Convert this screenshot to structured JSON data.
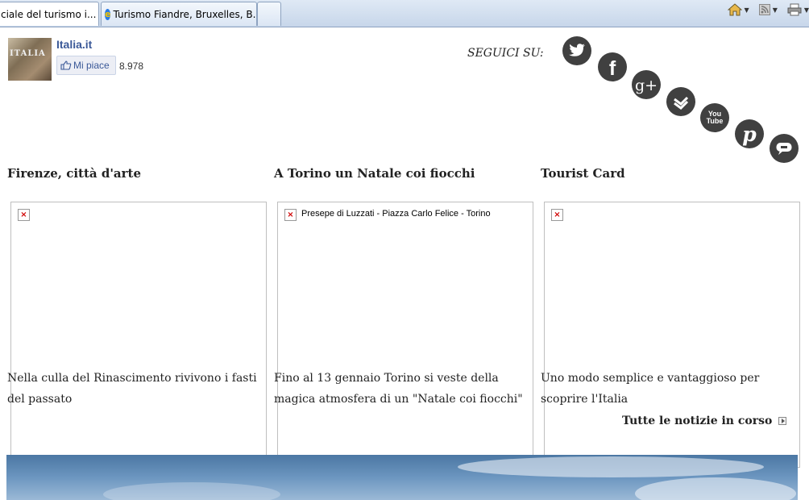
{
  "browser": {
    "tabs": [
      {
        "label": "ciale del turismo i...",
        "active": true
      },
      {
        "label": "Turismo Fiandre, Bruxelles, B...",
        "active": false
      },
      {
        "label": "",
        "active": false
      }
    ],
    "tools": [
      "home-icon",
      "feed-icon",
      "print-icon"
    ]
  },
  "header": {
    "site_name": "Italia.it",
    "thumb_text": "ITALIA",
    "like_label": "Mi piace",
    "like_count": "8.978",
    "follow_label": "SEGUICI SU:",
    "social": [
      "twitter",
      "facebook",
      "google-plus",
      "foursquare",
      "youtube",
      "pinterest",
      "chat"
    ]
  },
  "news": [
    {
      "title": "Firenze, città d'arte",
      "image_alt": "",
      "description": "Nella culla del Rinascimento rivivono i fasti del passato"
    },
    {
      "title": "A Torino un Natale coi fiocchi",
      "image_alt": "Presepe di Luzzati - Piazza Carlo Felice - Torino",
      "description": "Fino al 13 gennaio Torino si veste della magica atmosfera di un \"Natale coi fiocchi\""
    },
    {
      "title": "Tourist Card",
      "image_alt": "",
      "description": "Uno modo semplice e vantaggioso per scoprire l'Italia"
    }
  ],
  "more_link": "Tutte le notizie in corso",
  "colors": {
    "social_bg": "#404040",
    "fb_blue": "#3b5998",
    "broken_x": "#d00000"
  }
}
